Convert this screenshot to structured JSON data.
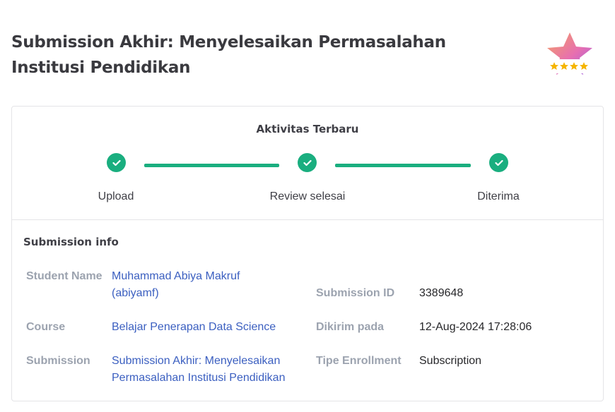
{
  "page": {
    "title": "Submission Akhir: Menyelesaikan Permasalahan Institusi Pendidikan"
  },
  "badge": {
    "icon": "star-rating-badge-icon",
    "stars": 4
  },
  "activity": {
    "title": "Aktivitas Terbaru",
    "steps": [
      {
        "label": "Upload",
        "status": "done"
      },
      {
        "label": "Review selesai",
        "status": "done"
      },
      {
        "label": "Diterima",
        "status": "done"
      }
    ],
    "accent_color": "#1aae7f"
  },
  "submission_info": {
    "title": "Submission info",
    "student_name_label": "Student Name",
    "student_name_line1": "Muhammad Abiya Makruf",
    "student_name_line2": "(abiyamf)",
    "submission_id_label": "Submission ID",
    "submission_id_value": "3389648",
    "course_label": "Course",
    "course_value": "Belajar Penerapan Data Science",
    "dikirim_pada_label": "Dikirim pada",
    "dikirim_pada_value": "12-Aug-2024 17:28:06",
    "submission_label": "Submission",
    "submission_line1": "Submission Akhir: Menyelesaikan",
    "submission_line2": "Permasalahan Institusi Pendidikan",
    "tipe_enrollment_label": "Tipe Enrollment",
    "tipe_enrollment_value": "Subscription"
  }
}
